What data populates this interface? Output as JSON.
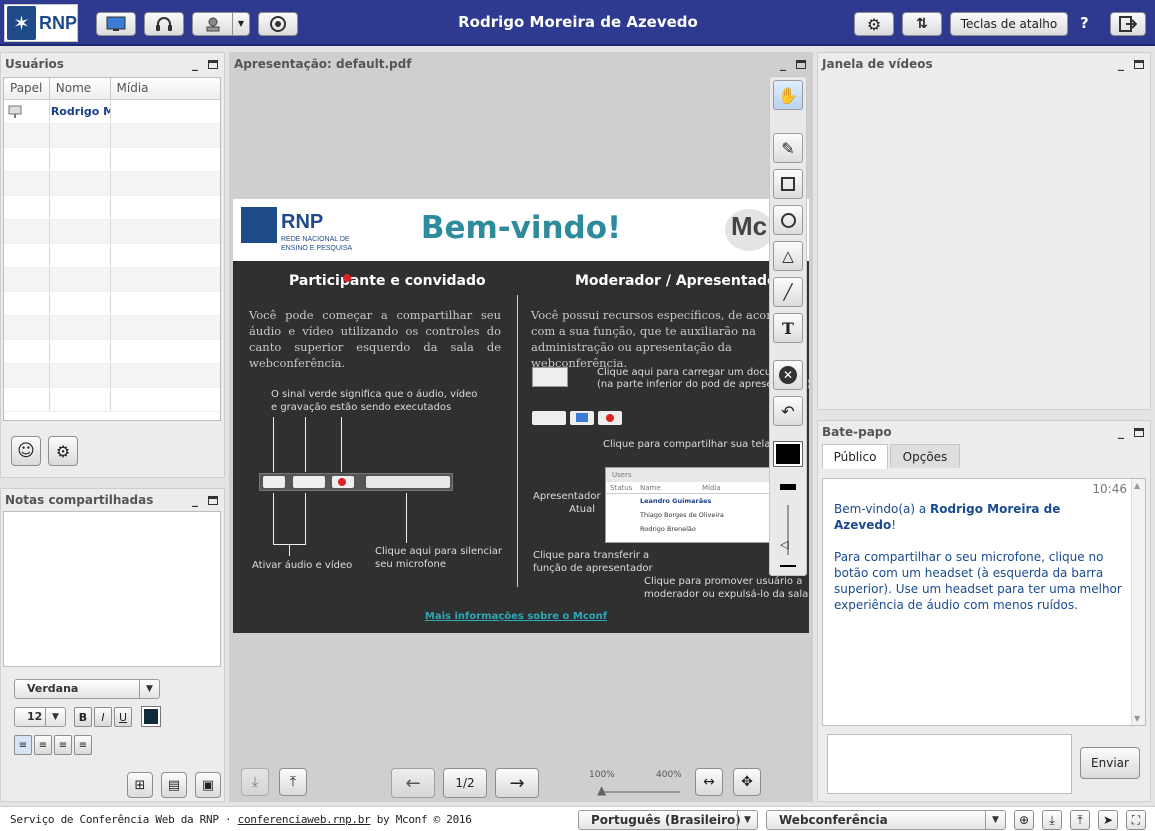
{
  "app": {
    "logo_text": "RNP",
    "title": "Rodrigo Moreira de Azevedo",
    "shortcut_label": "Teclas de atalho",
    "help_label": "?"
  },
  "users_panel": {
    "title": "Usuários",
    "columns": [
      "Papel",
      "Nome",
      "Mídia"
    ],
    "rows": [
      {
        "name": "Rodrigo Moreira de Azevedo"
      }
    ]
  },
  "notes_panel": {
    "title": "Notas compartilhadas",
    "font": "Verdana",
    "size": "12",
    "bold": "B",
    "italic": "I",
    "underline": "U"
  },
  "presentation": {
    "title": "Apresentação: default.pdf",
    "page": "1/2",
    "zoom_min": "100%",
    "zoom_max": "400%",
    "zoom_level": 0.0
  },
  "slide": {
    "title": "Bem-vindo!",
    "logo_text": "RNP",
    "logo_sub1": "REDE NACIONAL DE",
    "logo_sub2": "ENSINO E PESQUISA",
    "mconf_logo": "Mc",
    "left_heading": "Participante e convidado",
    "left_text": "Você pode começar a compartilhar seu áudio e vídeo utilizando os controles do canto superior esquerdo da sala de webconferência.",
    "green_note_1": "O sinal verde significa que o áudio, vídeo",
    "green_note_2": "e gravação estão sendo executados",
    "activate_av": "Ativar áudio e vídeo",
    "mute_note_1": "Clique aqui para silenciar",
    "mute_note_2": "seu microfone",
    "right_heading": "Moderador / Apresentador",
    "right_text": "Você possui recursos específicos, de acordo com a sua função, que te auxiliarão na administração ou apresentação da webconferência.",
    "upload_note_1": "Clique aqui para carregar um documento",
    "upload_note_2": "(na parte inferior do pod de apresentação)",
    "share_screen_note": "Clique para compartilhar sua tela",
    "mini_users_title": "Users",
    "mini_cols": [
      "Status",
      "Name",
      "Mídia"
    ],
    "mini_rows": [
      "Leandro Guimarães",
      "Thiago Borges de Oliveira",
      "Rodrigo Brenelão"
    ],
    "current_presenter_1": "Apresentador",
    "current_presenter_2": "Atual",
    "transfer_note_1": "Clique para transferir a",
    "transfer_note_2": "função de apresentador",
    "promote_note_1": "Clique para promover usuário a",
    "promote_note_2": "moderador ou expulsá-lo da sala",
    "more_info": "Mais informações sobre o Mconf"
  },
  "video_panel": {
    "title": "Janela de vídeos"
  },
  "chat_panel": {
    "title": "Bate-papo",
    "tabs": [
      "Público",
      "Opções"
    ],
    "time": "10:46",
    "welcome_prefix": "Bem-vindo(a) a ",
    "welcome_name": "Rodrigo Moreira de Azevedo",
    "welcome_suffix": "!",
    "message": "Para compartilhar o seu microfone, clique no botão com um headset (à esquerda da barra superior). Use um headset para ter uma melhor experiência de áudio com menos ruídos.",
    "send_label": "Enviar"
  },
  "footer": {
    "text_prefix": "Serviço de Conferência Web da RNP · ",
    "link": "conferenciaweb.rnp.br",
    "text_suffix": " by Mconf © 2016",
    "language": "Português (Brasileiro)",
    "layout": "Webconferência"
  }
}
